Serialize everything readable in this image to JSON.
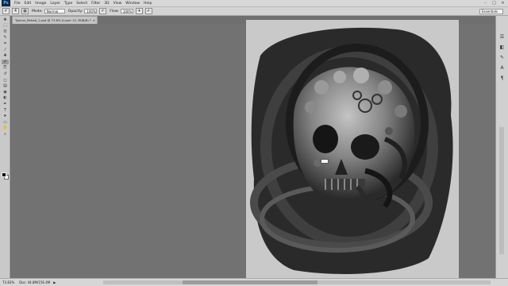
{
  "menubar": {
    "app_logo": "Ps",
    "items": [
      "File",
      "Edit",
      "Image",
      "Layer",
      "Type",
      "Select",
      "Filter",
      "3D",
      "View",
      "Window",
      "Help"
    ],
    "window_controls": [
      "–",
      "□",
      "×"
    ]
  },
  "options": {
    "brush_size": "4",
    "mode_label": "Mode:",
    "mode_value": "Normal",
    "opacity_label": "Opacity:",
    "opacity_value": "100%",
    "flow_label": "Flow:",
    "flow_value": "100%",
    "workspace": "Essentials"
  },
  "document": {
    "tab_title": "Typhus_Rehab_1.psd @ 73.8% (Layer 12, RGB/8) *",
    "close_glyph": "×"
  },
  "status": {
    "zoom": "73.83%",
    "doc_size": "Doc: 44.8M/156.4M",
    "arrow": "▶"
  },
  "canvas_hud": "",
  "tools": [
    "move-icon",
    "marquee-icon",
    "lasso-icon",
    "quick-select-icon",
    "crop-icon",
    "eyedropper-icon",
    "healing-icon",
    "brush-icon",
    "clone-stamp-icon",
    "history-brush-icon",
    "eraser-icon",
    "gradient-icon",
    "blur-icon",
    "dodge-icon",
    "pen-icon",
    "type-icon",
    "path-select-icon",
    "shape-icon",
    "hand-icon",
    "zoom-icon"
  ],
  "tool_glyphs": [
    "✥",
    "⬚",
    "ʘ",
    "✎",
    "⌗",
    "⁄",
    "✚",
    "✐",
    "⎘",
    "↺",
    "◻",
    "▤",
    "◉",
    "◐",
    "✒",
    "T",
    "➤",
    "▭",
    "✋",
    "⌕"
  ],
  "active_tool_index": 7,
  "right_panel_icons": [
    {
      "name": "layers-panel-icon",
      "glyph": "☰"
    },
    {
      "name": "adjustments-panel-icon",
      "glyph": "◧"
    },
    {
      "name": "brush-panel-icon",
      "glyph": "✎"
    },
    {
      "name": "character-panel-icon",
      "glyph": "A"
    },
    {
      "name": "paragraph-panel-icon",
      "glyph": "¶"
    }
  ]
}
